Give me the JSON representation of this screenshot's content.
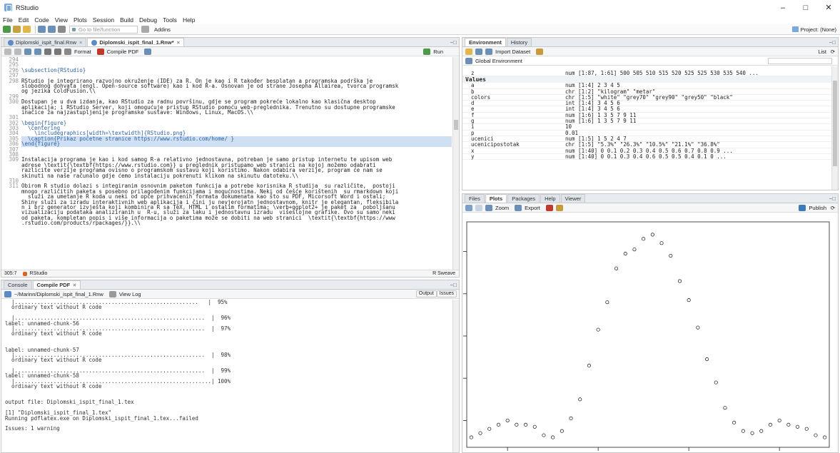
{
  "app": {
    "title": "RStudio"
  },
  "menu": [
    "File",
    "Edit",
    "Code",
    "View",
    "Plots",
    "Session",
    "Build",
    "Debug",
    "Tools",
    "Help"
  ],
  "toolbar": {
    "goto_placeholder": "Go to file/function",
    "addins": "Addins",
    "project": "Project: (None)"
  },
  "source": {
    "tabs": [
      {
        "label": "Diplomski_ispit_final.Rnw",
        "active": false
      },
      {
        "label": "Diplomski_ispit_final_1.Rnw*",
        "active": true
      }
    ],
    "format_label": "Format",
    "compile_label": "Compile PDF",
    "run_label": "Run",
    "status_pos": "305:7",
    "status_file": "RStudio",
    "status_mode": "R Sweave",
    "lines": [
      {
        "n": "294",
        "t": ""
      },
      {
        "n": "295",
        "t": ""
      },
      {
        "n": "296",
        "t": "\\subsection{RStudio}"
      },
      {
        "n": "297",
        "t": ""
      },
      {
        "n": "298",
        "t": "RStudio je integrirano razvojno okruženje (IDE) za R. On je kao i R također besplatan a programska podrška je"
      },
      {
        "n": "",
        "t": "slobodnog dohvata (engl. Open-source software) kao i kod R-a. Osnovan je od strane Josepha Allairea, tvorca programsk"
      },
      {
        "n": "",
        "t": "og jezika ColdFusion.\\\\"
      },
      {
        "n": "299",
        "t": ""
      },
      {
        "n": "300",
        "t": "Dostupan je u dva izdanja, kao RStudio za radnu površinu, gdje se program pokreće lokalno kao klasična desktop"
      },
      {
        "n": "",
        "t": "aplikacija; i RStudio Server, koji omogućuje pristup RStudio pomoću web-preglednika. Trenutno su dostupne programske"
      },
      {
        "n": "",
        "t": "inačice za najzastupljenije programske sustave: Windows, Linux, MacOS.\\\\"
      },
      {
        "n": "301",
        "t": ""
      },
      {
        "n": "302",
        "t": "\\begin{figure}"
      },
      {
        "n": "303",
        "t": "  \\centering"
      },
      {
        "n": "304",
        "t": "    \\includegraphics[width=\\textwidth]{RStudio.png}"
      },
      {
        "n": "305",
        "t": "  \\caption{Prikaz početne stranice https://www.rstudio.com/home/ }"
      },
      {
        "n": "306",
        "t": "\\end{figure}"
      },
      {
        "n": "307",
        "t": ""
      },
      {
        "n": "308",
        "t": ""
      },
      {
        "n": "309",
        "t": "Instalacija programa je kao i kod samog R-a relativno jednostavna, potreban je samo pristup internetu te upisom web"
      },
      {
        "n": "",
        "t": "adrese \\textit{\\textbf{https://www.rstudio.com}} u preglednik pristupamo web stranici na kojoj možemo odabrati"
      },
      {
        "n": "",
        "t": "razlicite verzije programa ovisno o programskom sustavu koji koristimo. Nakon odabira verzije, program će nam se"
      },
      {
        "n": "",
        "t": "skinuti na naše računalo gdje ćemo instalaciju pokrenuti klikom na skinutu datoteku.\\\\"
      },
      {
        "n": "310",
        "t": ""
      },
      {
        "n": "311",
        "t": "Obirom R studio dolazi s integiranim osnovnim paketom funkcija a potrebe korisnika R studija  su različite,  postoji"
      },
      {
        "n": "",
        "t": "mnogo različitih paketa s posebno prilagođenim funkcijama i mogućnostima. Neki od češće korištenih  su rmarkdown koji"
      },
      {
        "n": "",
        "t": "  služi za umetanje R koda u neki od opće prihvaćenih formata dokumenata kao što su PDF, Micorsoft Word i ostali;"
      },
      {
        "n": "",
        "t": "Shiny služi za izradu interaktivnih web aplikacija i čini ju nevjerojatn jednostavnom, knitr je elegantan, fleksibila"
      },
      {
        "n": "",
        "t": "n i brz generator izvješta koji kombinira R sa TeX, HTML i ostalim formatima; \\verb+ggplot2+ je paket za  poboljšanu"
      },
      {
        "n": "",
        "t": "vizualizaciju podataka analiziranih u  R-u, služi za laku i jednostavnu izradu  višeslojne grafike. Ovo su samo neki"
      },
      {
        "n": "",
        "t": "od paketa, kompletan popis i više informacija o paketima može se dobiti na web stranici  \\textit{\\textbf{https://www"
      },
      {
        "n": "",
        "t": ".rstudio.com/products/rpackages/}}.\\\\"
      }
    ]
  },
  "console": {
    "tabs": [
      {
        "label": "Console",
        "active": false
      },
      {
        "label": "Compile PDF",
        "active": true
      }
    ],
    "path": "~/Marinn/Diplomski_ispit_final_1.Rnw",
    "viewlog": "View Log",
    "output_btn": "Output",
    "issues_btn": "Issues",
    "lines": [
      "  |.........................................................   |  95%",
      "  ordinary text without R code",
      "",
      "  |...........................................................  |  96%",
      "label: unnamed-chunk-56",
      "  |...........................................................  |  97%",
      "  ordinary text without R code",
      "",
      "",
      "label: unnamed-chunk-57",
      "  |...........................................................  |  98%",
      "  ordinary text without R code",
      "",
      "  |...........................................................  |  99%",
      "label: unnamed-chunk-58",
      "  |.............................................................| 100%",
      "  ordinary text without R code",
      "",
      "",
      "output file: Diplomski_ispit_final_1.tex",
      "",
      "[1] \"Diplomski_ispit_final_1.tex\"",
      "Running pdflatex.exe on Diplomski_ispit_final_1.tex...failed",
      "",
      "Issues: 1 warning"
    ]
  },
  "environment": {
    "tabs": [
      {
        "label": "Environment",
        "active": true
      },
      {
        "label": "History",
        "active": false
      }
    ],
    "import_label": "Import Dataset",
    "list_label": "List",
    "scope": "Global Environment",
    "top_row": {
      "name": "z",
      "value": "num [1:87, 1:61] 500 505 510 515 520 525 525 530 535 540 ..."
    },
    "section": "Values",
    "rows": [
      {
        "name": "a",
        "value": "num [1:4] 2 3 4 5"
      },
      {
        "name": "b",
        "value": "chr [1:2] \"kilogram\" \"metar\""
      },
      {
        "name": "colors",
        "value": "chr [1:5] \"white\" \"grey70\" \"grey90\" \"grey50\" \"black\""
      },
      {
        "name": "d",
        "value": "int [1:4] 3 4 5 6"
      },
      {
        "name": "e",
        "value": "int [1:4] 3 4 5 6"
      },
      {
        "name": "f",
        "value": "num [1:6] 1 3 5 7 9 11"
      },
      {
        "name": "g",
        "value": "num [1:6] 1 3 5 7 9 11"
      },
      {
        "name": "i",
        "value": "10"
      },
      {
        "name": "p",
        "value": "0.01"
      },
      {
        "name": "ucenici",
        "value": "num [1:5] 1 5 2 4 7"
      },
      {
        "name": "ucenicipostotak",
        "value": "chr [1:5] \"5.3%\" \"26.3%\" \"10.5%\" \"21.1%\" \"36.8%\""
      },
      {
        "name": "x",
        "value": "num [1:40] 0 0.1 0.2 0.3 0.4 0.5 0.6 0.7 0.8 0.9 ..."
      },
      {
        "name": "y",
        "value": "num [1:40] 0 0.1 0.3 0.4 0.6 0.5 0.5 0.4 0.1 0 ..."
      }
    ]
  },
  "files": {
    "tabs": [
      {
        "label": "Files",
        "active": false
      },
      {
        "label": "Plots",
        "active": true
      },
      {
        "label": "Packages",
        "active": false
      },
      {
        "label": "Help",
        "active": false
      },
      {
        "label": "Viewer",
        "active": false
      }
    ],
    "zoom_label": "Zoom",
    "export_label": "Export",
    "publish_label": "Publish"
  },
  "chart_data": {
    "type": "scatter",
    "title": "",
    "xlabel": "",
    "ylabel": "",
    "points": [
      {
        "x": 1,
        "y": 0.02
      },
      {
        "x": 2,
        "y": 0.04
      },
      {
        "x": 3,
        "y": 0.06
      },
      {
        "x": 4,
        "y": 0.08
      },
      {
        "x": 5,
        "y": 0.1
      },
      {
        "x": 6,
        "y": 0.08
      },
      {
        "x": 7,
        "y": 0.08
      },
      {
        "x": 8,
        "y": 0.07
      },
      {
        "x": 9,
        "y": 0.03
      },
      {
        "x": 10,
        "y": 0.02
      },
      {
        "x": 11,
        "y": 0.05
      },
      {
        "x": 12,
        "y": 0.11
      },
      {
        "x": 13,
        "y": 0.2
      },
      {
        "x": 14,
        "y": 0.36
      },
      {
        "x": 15,
        "y": 0.53
      },
      {
        "x": 16,
        "y": 0.66
      },
      {
        "x": 17,
        "y": 0.82
      },
      {
        "x": 18,
        "y": 0.89
      },
      {
        "x": 19,
        "y": 0.91
      },
      {
        "x": 20,
        "y": 0.96
      },
      {
        "x": 21,
        "y": 0.98
      },
      {
        "x": 22,
        "y": 0.94
      },
      {
        "x": 23,
        "y": 0.88
      },
      {
        "x": 24,
        "y": 0.76
      },
      {
        "x": 25,
        "y": 0.67
      },
      {
        "x": 26,
        "y": 0.54
      },
      {
        "x": 27,
        "y": 0.39
      },
      {
        "x": 28,
        "y": 0.28
      },
      {
        "x": 29,
        "y": 0.16
      },
      {
        "x": 30,
        "y": 0.09
      },
      {
        "x": 31,
        "y": 0.05
      },
      {
        "x": 32,
        "y": 0.04
      },
      {
        "x": 33,
        "y": 0.05
      },
      {
        "x": 34,
        "y": 0.08
      },
      {
        "x": 35,
        "y": 0.1
      },
      {
        "x": 36,
        "y": 0.08
      },
      {
        "x": 37,
        "y": 0.07
      },
      {
        "x": 38,
        "y": 0.06
      },
      {
        "x": 39,
        "y": 0.03
      },
      {
        "x": 40,
        "y": 0.02
      }
    ],
    "xlim": [
      0.5,
      40.5
    ],
    "ylim": [
      0,
      1
    ]
  }
}
